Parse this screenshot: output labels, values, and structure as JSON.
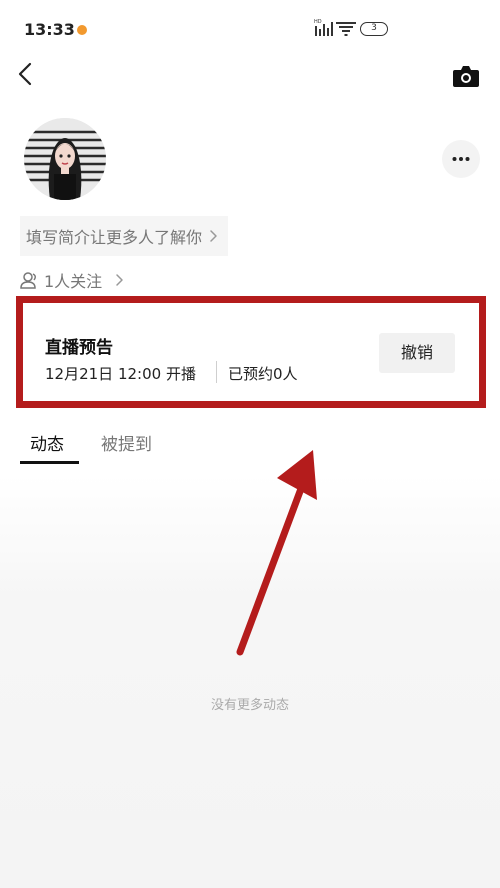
{
  "status_bar": {
    "time": "13:33",
    "battery_level": "3",
    "dot_color": "#f2992e"
  },
  "profile": {
    "bio_placeholder": "填写简介让更多人了解你",
    "followers_text": "1人关注"
  },
  "live_preview": {
    "title": "直播预告",
    "time_text": "12月21日 12:00 开播",
    "booked_text": "已预约0人",
    "cancel_label": "撤销",
    "highlight_color": "#b41c1c"
  },
  "tabs": [
    {
      "label": "动态",
      "active": true
    },
    {
      "label": "被提到",
      "active": false
    }
  ],
  "feed": {
    "empty_text": "没有更多动态"
  },
  "icons": [
    "back-icon",
    "camera-icon",
    "more-icon",
    "person-icon",
    "chevron-right-icon"
  ]
}
